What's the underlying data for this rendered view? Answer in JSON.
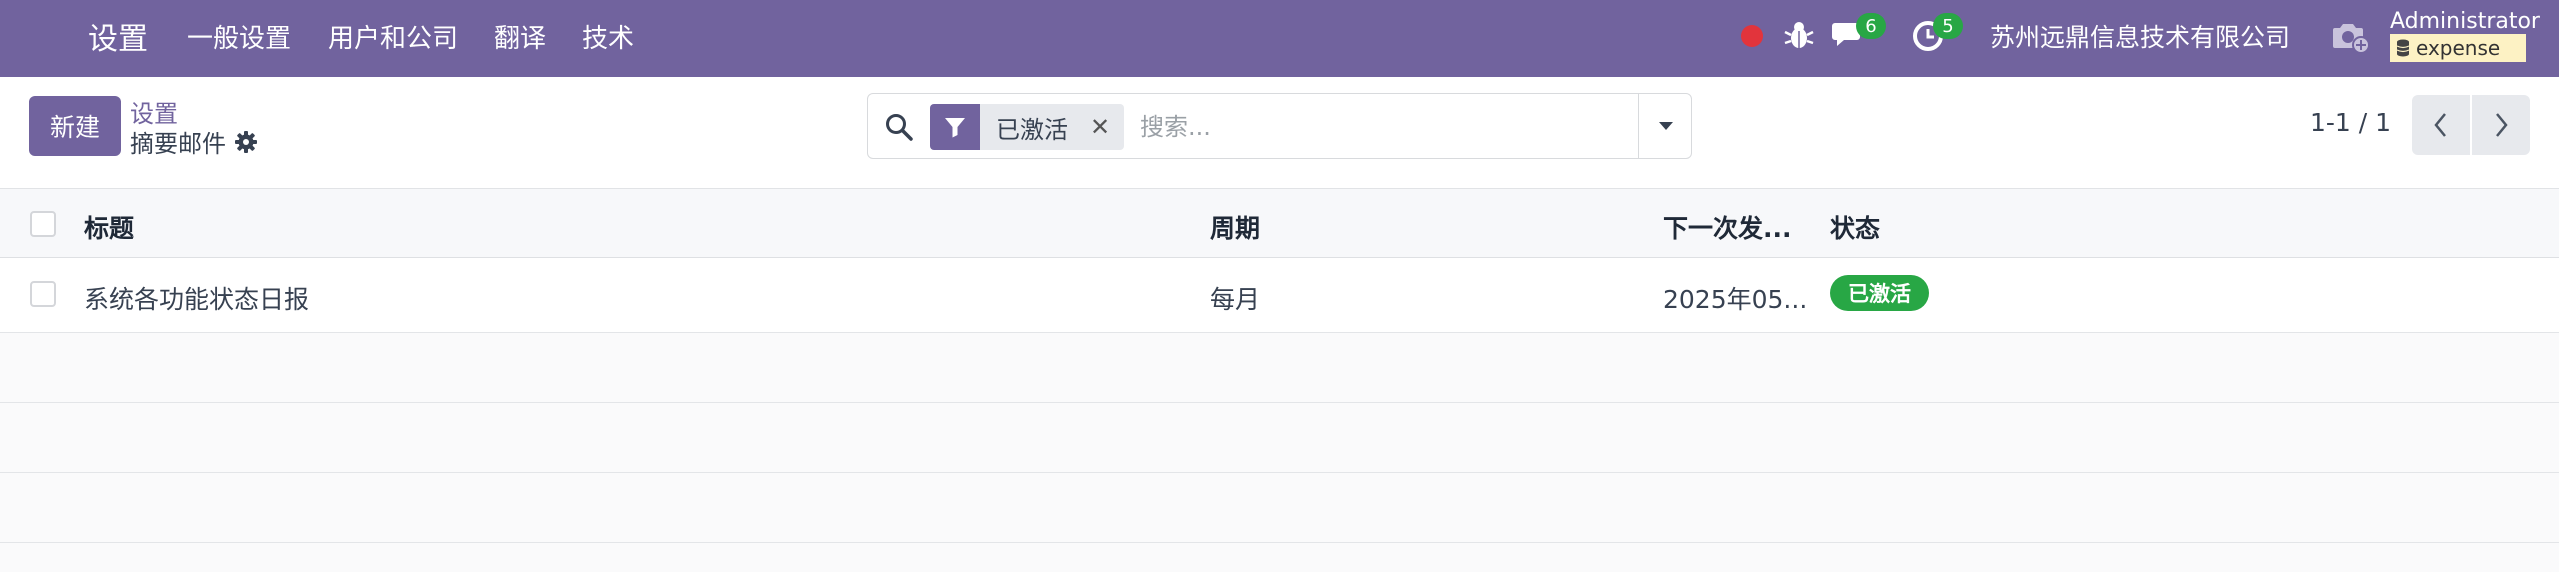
{
  "navbar": {
    "app_title": "设置",
    "menu": [
      "一般设置",
      "用户和公司",
      "翻译",
      "技术"
    ],
    "messages_count": "6",
    "activities_count": "5",
    "company": "苏州远鼎信息技术有限公司",
    "user": "Administrator",
    "database": "expense",
    "icons": [
      "apps-icon",
      "record-dot-icon",
      "bug-icon",
      "chat-icon",
      "clock-icon",
      "camera-icon",
      "database-icon"
    ],
    "colors": {
      "brand": "#71639e",
      "badge": "#28a745",
      "record": "#e2343c"
    }
  },
  "control_panel": {
    "new_label": "新建",
    "breadcrumb_parent": "设置",
    "breadcrumb_current": "摘要邮件",
    "search": {
      "facet": "已激活",
      "placeholder": "搜索..."
    },
    "pager": "1-1 / 1"
  },
  "table": {
    "columns": [
      "标题",
      "周期",
      "下一次发...",
      "状态"
    ],
    "rows": [
      {
        "title": "系统各功能状态日报",
        "period": "每月",
        "next_date": "2025年05...",
        "status": "已激活"
      }
    ]
  }
}
